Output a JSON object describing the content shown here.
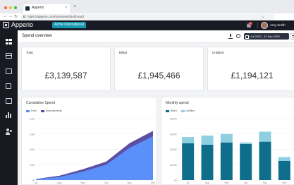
{
  "browser": {
    "tab_title": "Apperio",
    "tab_close": "×",
    "new_tab": "+",
    "url": "https://apperio.com/business/dashboard",
    "window_dots": [
      "#ff5f57",
      "#febc2e",
      "#28c840"
    ]
  },
  "app": {
    "brand": "Apperio",
    "company_button": "Acme International",
    "notification_count": "1",
    "user_name": "Amy Smith"
  },
  "toolbar": {
    "title": "Spend overview",
    "date_range": "1 Jul 2020 - 31 Dec 2020"
  },
  "kpis": [
    {
      "label": "Total",
      "value": "£3,139,587"
    },
    {
      "label": "Billed",
      "value": "£1,945,466"
    },
    {
      "label": "Unbilled",
      "value": "£1,194,121"
    }
  ],
  "sidebar": {
    "items": [
      "dashboard-icon",
      "card-icon",
      "stack-icon",
      "receipt-icon",
      "calendar-icon",
      "chart-icon",
      "users-icon"
    ]
  },
  "colors": {
    "nav_bg": "#181a22",
    "accent": "#1497b0",
    "fees": "#5b8ff9",
    "disbursements": "#5b4fa3",
    "billed": "#0e6e8c",
    "unbilled": "#8fd0e0"
  },
  "chart_data": [
    {
      "type": "area",
      "title": "Cumulative Spend",
      "categories": [
        "Jul",
        "Aug",
        "Sep",
        "Oct",
        "Nov",
        "Dec"
      ],
      "series": [
        {
          "name": "Fees",
          "values": [
            0.05,
            0.2,
            0.55,
            1.0,
            2.1,
            2.85
          ]
        },
        {
          "name": "Disbursements",
          "values": [
            0.02,
            0.08,
            0.15,
            0.2,
            0.3,
            0.35
          ]
        }
      ],
      "yticks": [
        "£0",
        "£1M",
        "£2M",
        "£3M",
        "£4M"
      ],
      "ylim": [
        0,
        4
      ],
      "stacked": true,
      "legend": "top-left"
    },
    {
      "type": "bar",
      "title": "Monthly spend",
      "categories": [
        "Jul",
        "Aug",
        "Sep",
        "Oct",
        "Nov",
        "Dec"
      ],
      "series": [
        {
          "name": "Billed",
          "values": [
            480,
            460,
            490,
            470,
            500,
            250
          ]
        },
        {
          "name": "Unbilled",
          "values": [
            80,
            120,
            110,
            20,
            130,
            50
          ]
        }
      ],
      "yticks": [
        "£0",
        "£200K",
        "£400K",
        "£600K",
        "£800K"
      ],
      "ylim": [
        0,
        800
      ],
      "stacked": true,
      "legend": "top-left"
    }
  ]
}
